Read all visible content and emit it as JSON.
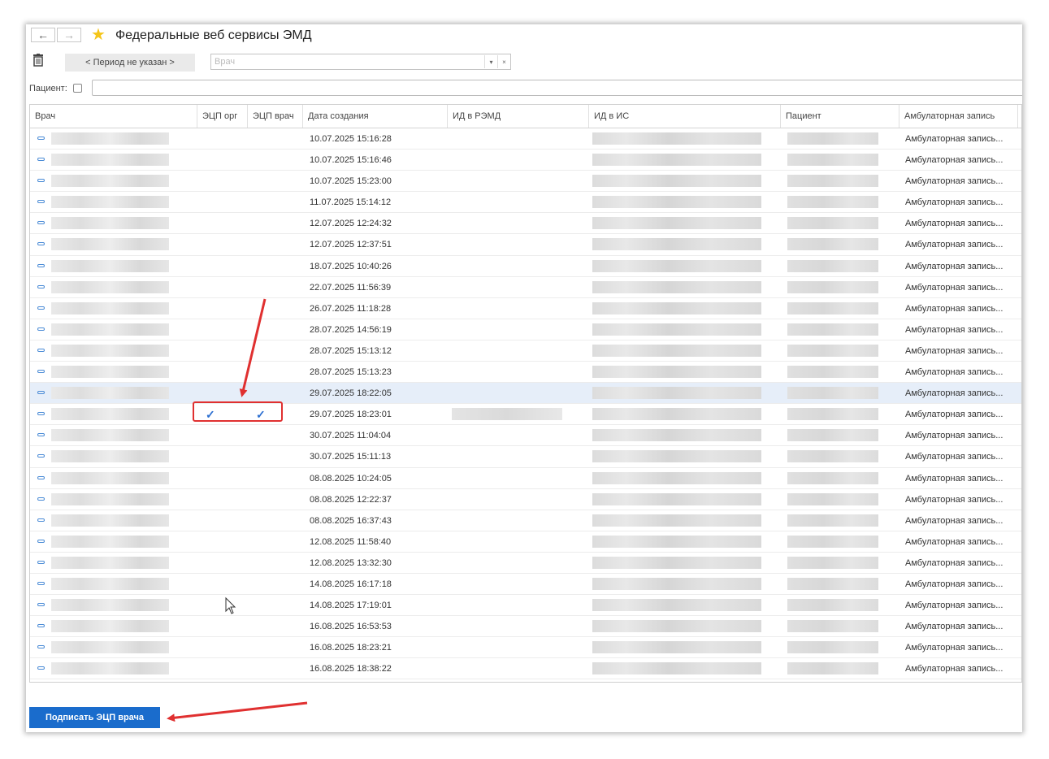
{
  "window": {
    "title": "Федеральные веб сервисы ЭМД",
    "back_icon": "←",
    "forward_icon": "→",
    "favorite_icon": "★"
  },
  "toolbar": {
    "period_label": "< Период не указан >",
    "doctor_placeholder": "Врач",
    "dropdown_icon": "▾",
    "clear_icon": "×"
  },
  "filter": {
    "patient_label": "Пациент:"
  },
  "table": {
    "columns": [
      "Врач",
      "ЭЦП орг",
      "ЭЦП врач",
      "Дата создания",
      "ИД в РЭМД",
      "ИД в ИС",
      "Пациент",
      "Амбулаторная запись"
    ],
    "rows": [
      {
        "date": "10.07.2025 15:16:28",
        "amb": "Амбулаторная запись...",
        "org": "",
        "doc": ""
      },
      {
        "date": "10.07.2025 15:16:46",
        "amb": "Амбулаторная запись...",
        "org": "",
        "doc": ""
      },
      {
        "date": "10.07.2025 15:23:00",
        "amb": "Амбулаторная запись...",
        "org": "",
        "doc": ""
      },
      {
        "date": "11.07.2025 15:14:12",
        "amb": "Амбулаторная запись...",
        "org": "",
        "doc": ""
      },
      {
        "date": "12.07.2025 12:24:32",
        "amb": "Амбулаторная запись...",
        "org": "",
        "doc": ""
      },
      {
        "date": "12.07.2025 12:37:51",
        "amb": "Амбулаторная запись...",
        "org": "",
        "doc": ""
      },
      {
        "date": "18.07.2025 10:40:26",
        "amb": "Амбулаторная запись...",
        "org": "",
        "doc": ""
      },
      {
        "date": "22.07.2025 11:56:39",
        "amb": "Амбулаторная запись...",
        "org": "",
        "doc": ""
      },
      {
        "date": "26.07.2025 11:18:28",
        "amb": "Амбулаторная запись...",
        "org": "",
        "doc": ""
      },
      {
        "date": "28.07.2025 14:56:19",
        "amb": "Амбулаторная запись...",
        "org": "",
        "doc": ""
      },
      {
        "date": "28.07.2025 15:13:12",
        "amb": "Амбулаторная запись...",
        "org": "",
        "doc": ""
      },
      {
        "date": "28.07.2025 15:13:23",
        "amb": "Амбулаторная запись...",
        "org": "",
        "doc": ""
      },
      {
        "date": "29.07.2025 18:22:05",
        "amb": "Амбулаторная запись...",
        "org": "",
        "doc": "",
        "selected": true
      },
      {
        "date": "29.07.2025 18:23:01",
        "amb": "Амбулаторная запись...",
        "org": "✓",
        "doc": "✓",
        "remd": true
      },
      {
        "date": "30.07.2025 11:04:04",
        "amb": "Амбулаторная запись...",
        "org": "",
        "doc": ""
      },
      {
        "date": "30.07.2025 15:11:13",
        "amb": "Амбулаторная запись...",
        "org": "",
        "doc": ""
      },
      {
        "date": "08.08.2025 10:24:05",
        "amb": "Амбулаторная запись...",
        "org": "",
        "doc": ""
      },
      {
        "date": "08.08.2025 12:22:37",
        "amb": "Амбулаторная запись...",
        "org": "",
        "doc": ""
      },
      {
        "date": "08.08.2025 16:37:43",
        "amb": "Амбулаторная запись...",
        "org": "",
        "doc": ""
      },
      {
        "date": "12.08.2025 11:58:40",
        "amb": "Амбулаторная запись...",
        "org": "",
        "doc": ""
      },
      {
        "date": "12.08.2025 13:32:30",
        "amb": "Амбулаторная запись...",
        "org": "",
        "doc": ""
      },
      {
        "date": "14.08.2025 16:17:18",
        "amb": "Амбулаторная запись...",
        "org": "",
        "doc": ""
      },
      {
        "date": "14.08.2025 17:19:01",
        "amb": "Амбулаторная запись...",
        "org": "",
        "doc": ""
      },
      {
        "date": "16.08.2025 16:53:53",
        "amb": "Амбулаторная запись...",
        "org": "",
        "doc": ""
      },
      {
        "date": "16.08.2025 18:23:21",
        "amb": "Амбулаторная запись...",
        "org": "",
        "doc": ""
      },
      {
        "date": "16.08.2025 18:38:22",
        "amb": "Амбулаторная запись...",
        "org": "",
        "doc": ""
      }
    ]
  },
  "footer": {
    "sign_button": "Подписать ЭЦП врача"
  },
  "colors": {
    "accent": "#1a6ccc",
    "annotation": "#e03030",
    "check": "#2c6fd1"
  }
}
